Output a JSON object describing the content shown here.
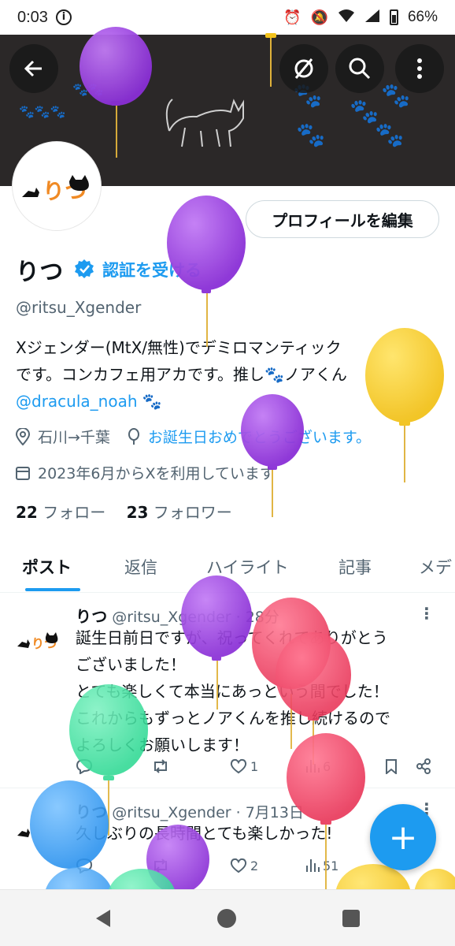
{
  "status_bar": {
    "time": "0:03",
    "battery": "66%"
  },
  "header": {
    "back_icon": "back-arrow-icon",
    "icons": [
      "sync-off-icon",
      "search-icon",
      "more-vertical-icon"
    ]
  },
  "profile": {
    "name": "りつ",
    "verify_link": "認証を受ける",
    "handle": "@ritsu_Xgender",
    "edit_button": "プロフィールを編集",
    "bio_line1": "Xジェンダー(MtX/無性)でデミロマンティック",
    "bio_line2": "です。コンカフェ用アカです。推し🐾ノアくん",
    "bio_mention": "@dracula_noah",
    "bio_paw": "🐾",
    "location": "石川→千葉",
    "birthday_link": "お誕生日おめでとうございます。",
    "joined": "2023年6月からXを利用しています",
    "following_count": "22",
    "following_label": "フォロー",
    "followers_count": "23",
    "followers_label": "フォロワー"
  },
  "tabs": [
    {
      "label": "ポスト",
      "active": true
    },
    {
      "label": "返信"
    },
    {
      "label": "ハイライト"
    },
    {
      "label": "記事"
    },
    {
      "label": "メデ"
    }
  ],
  "posts": [
    {
      "name": "りつ",
      "handle_time": "@ritsu_Xgender · 28分",
      "lines": [
        "誕生日前日ですが、祝ってくれてありがとう",
        "ございました！",
        "とても楽しくて本当にあっという間でした！",
        "これからもずっとノアくんを推し続けるので",
        "よろしくお願いします！"
      ],
      "likes": "1",
      "views": "6"
    },
    {
      "name": "りつ",
      "handle_time": "@ritsu_Xgender · 7月13日",
      "lines": [
        "久しぶりの長時間とても楽しかった!"
      ],
      "likes": "2",
      "views": "51"
    }
  ],
  "fab_label": "+",
  "colors": {
    "accent": "#1d9bf0",
    "banner": "#2b2828",
    "purple": "#9b3ee0",
    "yellow": "#f5cf2a",
    "pink": "#ef4668",
    "green": "#3ee3a0",
    "blue": "#3aa0f5"
  }
}
